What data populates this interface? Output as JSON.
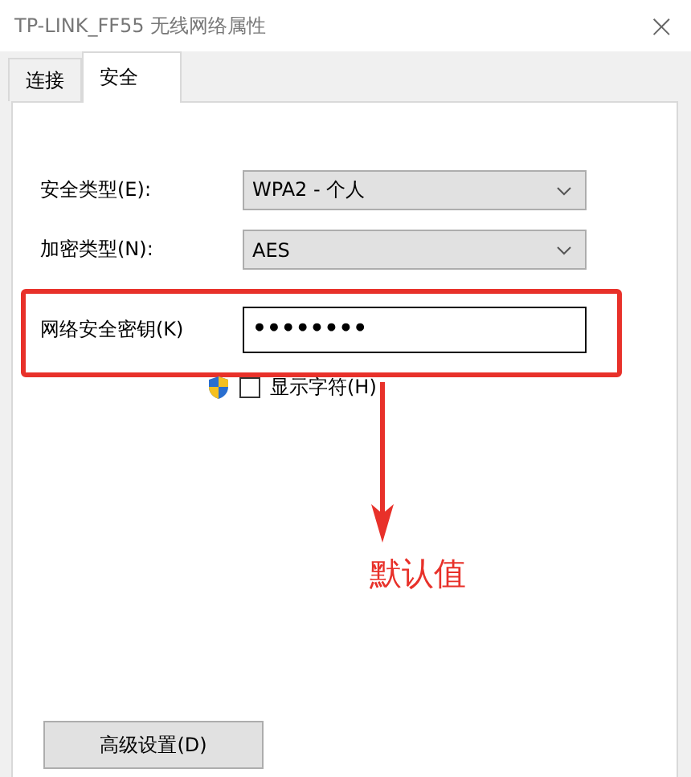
{
  "window": {
    "title": "TP-LINK_FF55 无线网络属性",
    "close": "×"
  },
  "tabs": [
    {
      "label": "连接",
      "selected": false
    },
    {
      "label": "安全",
      "selected": true
    }
  ],
  "fields": [
    {
      "kind": "dropdown",
      "label": "安全类型(E):",
      "value": "WPA2 - 个人"
    },
    {
      "kind": "dropdown",
      "label": "加密类型(N):",
      "value": "AES"
    },
    {
      "kind": "text",
      "label": "网络安全密钥(K)",
      "value": "••••••••",
      "highlighted": true
    }
  ],
  "show_characters": {
    "label": "显示字符(H)",
    "checked": false
  },
  "annotation": {
    "text": "默认值",
    "color": "#e8312a"
  },
  "advanced_button": "高级设置(D)"
}
